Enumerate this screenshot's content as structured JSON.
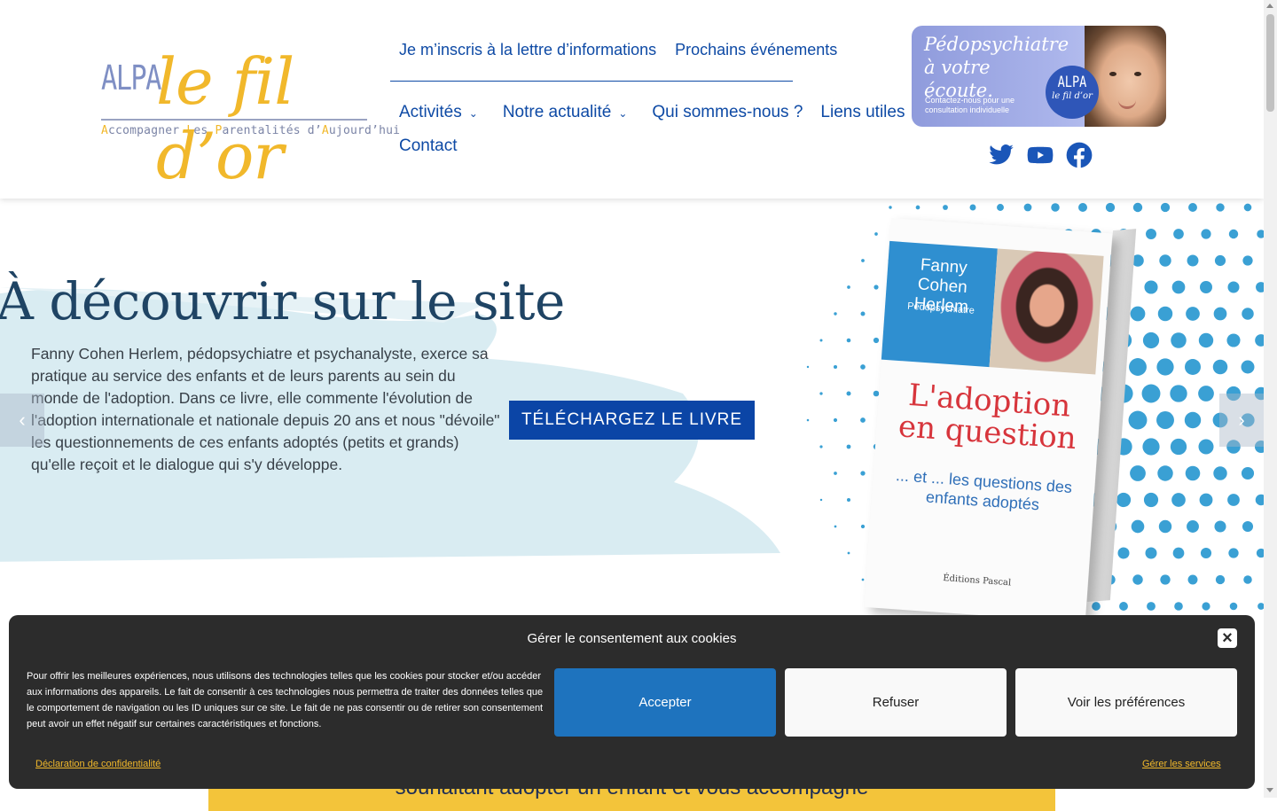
{
  "logo": {
    "alpa": "ALPA",
    "name": "le fil d’or",
    "tagline_parts": [
      "A",
      "ccompagner ",
      "L",
      "es ",
      "P",
      "arentalités d’",
      "A",
      "ujourd’hui"
    ]
  },
  "nav_top": [
    {
      "label": "Je m’inscris à la lettre d’informations"
    },
    {
      "label": "Prochains événements"
    }
  ],
  "nav_main": [
    {
      "label": "Activités",
      "has_dropdown": true
    },
    {
      "label": "Notre actualité",
      "has_dropdown": true
    },
    {
      "label": "Qui sommes-nous ?",
      "has_dropdown": false
    },
    {
      "label": "Liens utiles",
      "has_dropdown": false
    },
    {
      "label": "Contact",
      "has_dropdown": false
    }
  ],
  "banner": {
    "title": "Pédopsychiatre à votre écoute.",
    "subtitle": "Contactez-nous pour une consultation individuelle",
    "badge_alpa": "ALPA",
    "badge_name": "le fil d’or"
  },
  "social": [
    {
      "name": "twitter-icon",
      "color": "#1a56b8"
    },
    {
      "name": "youtube-icon",
      "color": "#1a56b8"
    },
    {
      "name": "facebook-icon",
      "color": "#1a56b8"
    }
  ],
  "hero": {
    "title": "À découvrir sur le site",
    "description": "Fanny Cohen Herlem, pédopsychiatre et psychanalyste, exerce sa pratique au service des enfants et de leurs parents au sein du monde de l'adoption. Dans ce livre, elle commente l'évolution de l'adoption internationale et nationale depuis 20 ans et nous \"dévoile\" les questionnements de ces enfants adoptés (petits et grands) qu'elle reçoit et le dialogue qui s'y développe.",
    "cta_label": "TÉLÉCHARGEZ LE LIVRE",
    "prev_icon": "chevron-left-icon",
    "next_icon": "chevron-right-icon"
  },
  "book": {
    "author": "Fanny Cohen Herlem",
    "role": "Pédopsychiatre",
    "title": "L'adoption en question",
    "subtitle": "... et ... les questions des enfants adoptés",
    "publisher": "Éditions Pascal"
  },
  "yellow_band": {
    "text": "souhaitant adopter un enfant et vous accompagne"
  },
  "cookie": {
    "title": "Gérer le consentement aux cookies",
    "text": "Pour offrir les meilleures expériences, nous utilisons des technologies telles que les cookies pour stocker et/ou accéder aux informations des appareils. Le fait de consentir à ces technologies nous permettra de traiter des données telles que le comportement de navigation ou les ID uniques sur ce site. Le fait de ne pas consentir ou de retirer son consentement peut avoir un effet négatif sur certaines caractéristiques et fonctions.",
    "accept": "Accepter",
    "refuse": "Refuser",
    "preferences": "Voir les préférences",
    "privacy_link": "Déclaration de confidentialité",
    "services_link": "Gérer les services",
    "close_icon": "close-icon"
  },
  "colors": {
    "primary_blue": "#0e4aa5",
    "logo_gold": "#f1b82b",
    "cookie_bg": "#2c2c2c",
    "accept_blue": "#1e73be"
  }
}
